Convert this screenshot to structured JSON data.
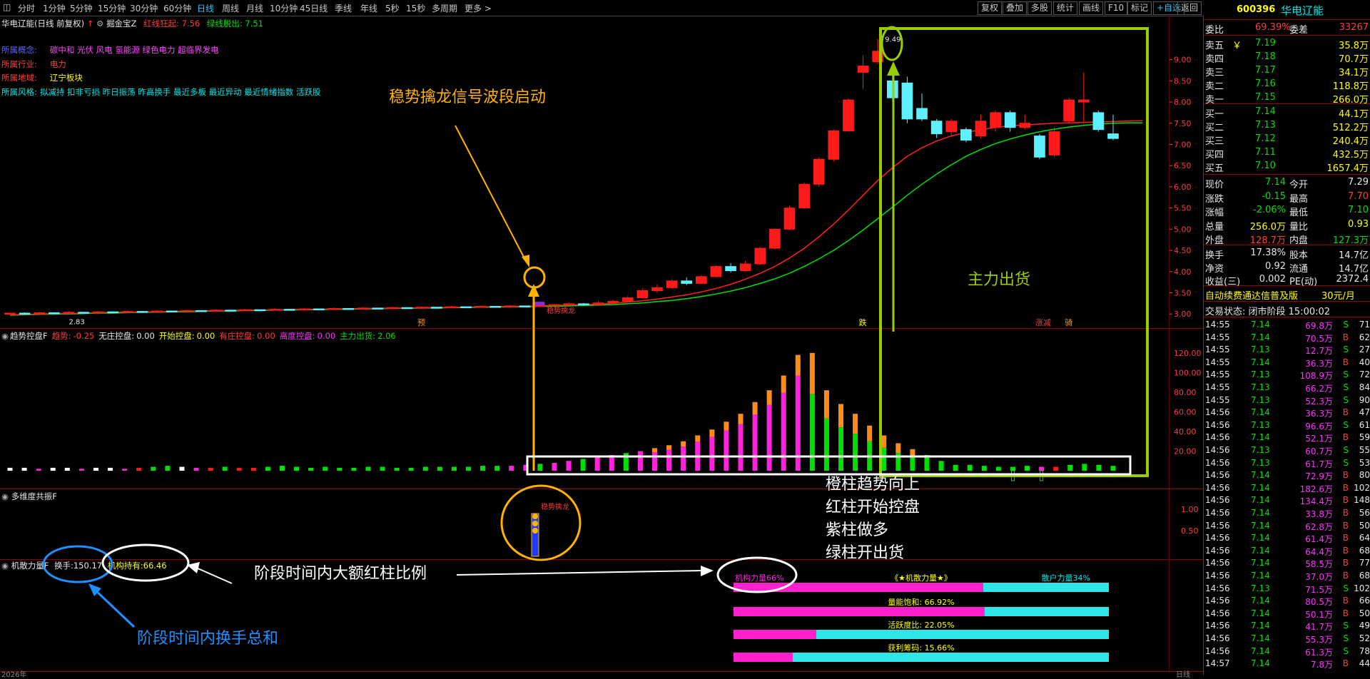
{
  "toolbar": {
    "periods": [
      "分时",
      "1分钟",
      "5分钟",
      "15分钟",
      "30分钟",
      "60分钟",
      "日线",
      "周线",
      "月线",
      "10分钟",
      "45日线",
      "季线",
      "年线",
      "5秒",
      "15秒",
      "多周期",
      "更多 >"
    ],
    "active_period": "日线",
    "buttons": [
      "复权",
      "叠加",
      "多股",
      "统计",
      "画线",
      "F10",
      "标记",
      "+自选",
      "返回"
    ]
  },
  "main_chart": {
    "title": "华电辽能(日线 前复权)",
    "indicator_name": "掘金宝Z",
    "red_line_label": "红线狂起: 7.56",
    "green_line_label": "绿线脱出: 7.51",
    "info_lines": [
      {
        "key": "所属概念:",
        "value": "碳中和 光伏 风电 氢能源 绿色电力 超临界发电",
        "key_color": "#6060ff",
        "value_color": "#ff44ff"
      },
      {
        "key": "所属行业:",
        "value": "电力",
        "key_color": "#ff3c3c",
        "value_color": "#ff3c3c"
      },
      {
        "key": "所属地域:",
        "value": "辽宁板块",
        "key_color": "#ff3c3c",
        "value_color": "#ffff00"
      },
      {
        "key": "所属风格:",
        "value": "拟减持 扣非亏损 昨日振荡 昨高换手 最近多板 最近异动 最近情绪指数 活跃股",
        "key_color": "#00e5e5",
        "value_color": "#00e5e5"
      }
    ],
    "y_ticks": [
      "9.00",
      "8.50",
      "8.00",
      "7.50",
      "7.00",
      "6.50",
      "6.00",
      "5.50",
      "5.00",
      "4.50",
      "4.00",
      "3.50",
      "3.00"
    ],
    "high_label": "9.49",
    "low_label": "2.83",
    "signal_label": "稳势擒龙",
    "bottom_marks": [
      "预",
      "跌",
      "涨减",
      "骑"
    ]
  },
  "trend_panel": {
    "title": "趋势控盘F",
    "fields": [
      {
        "label": "趋势:",
        "value": "-0.25",
        "color": "#ff3c3c"
      },
      {
        "label": "无庄控盘:",
        "value": "0.00",
        "color": "#e6e6e6"
      },
      {
        "label": "开始控盘:",
        "value": "0.00",
        "color": "#ffff00"
      },
      {
        "label": "有庄控盘:",
        "value": "0.00",
        "color": "#ff3c3c"
      },
      {
        "label": "高度控盘:",
        "value": "0.00",
        "color": "#ff33ff"
      },
      {
        "label": "主力出货:",
        "value": "2.06",
        "color": "#00e000"
      }
    ],
    "y_ticks": [
      "120.00",
      "100.00",
      "80.00",
      "60.00",
      "40.00",
      "20.00"
    ]
  },
  "resonance_panel": {
    "title": "多维度共振F",
    "signal_label": "稳势擒龙",
    "y_ticks": [
      "1.00",
      "0.50"
    ]
  },
  "force_panel": {
    "title": "机散力量F",
    "turnover_label": "换手:",
    "turnover_value": "150.17",
    "inst_label": "机构持有:",
    "inst_value": "66.46",
    "bars": [
      {
        "left_label": "机构力量66%",
        "center_label": "《★机散力量★》",
        "right_label": "散户力量34%",
        "fraction": 0.665
      },
      {
        "center_label": "量能饱和:  66.92%",
        "fraction": 0.669
      },
      {
        "center_label": "活跃度比:  22.05%",
        "fraction": 0.22
      },
      {
        "center_label": "获利筹码:  15.66%",
        "fraction": 0.157
      }
    ]
  },
  "footer": {
    "year_label": "2026年",
    "date_tick": "日线"
  },
  "annotations": {
    "signal_start": "稳势擒龙信号波段启动",
    "main_sell": "主力出货",
    "legend_lines": [
      "橙柱趋势向上",
      "红柱开始控盘",
      "紫柱做多",
      "绿柱开出货"
    ],
    "ratio_note": "阶段时间内大额红柱比例",
    "turnover_note": "阶段时间内换手总和"
  },
  "quote": {
    "code": "600396",
    "name": "华电辽能",
    "webi_label": "委比",
    "webi_value": "69.39%",
    "weicha_label": "委差",
    "weicha_value": "33267",
    "asks": [
      {
        "label": "卖五",
        "flag": "￥",
        "price": "7.19",
        "vol": "35.8万"
      },
      {
        "label": "卖四",
        "flag": "",
        "price": "7.18",
        "vol": "70.7万"
      },
      {
        "label": "卖三",
        "flag": "",
        "price": "7.17",
        "vol": "34.1万"
      },
      {
        "label": "卖二",
        "flag": "",
        "price": "7.16",
        "vol": "118.8万"
      },
      {
        "label": "卖一",
        "flag": "",
        "price": "7.15",
        "vol": "266.0万"
      }
    ],
    "bids": [
      {
        "label": "买一",
        "price": "7.14",
        "vol": "44.1万"
      },
      {
        "label": "买二",
        "price": "7.13",
        "vol": "512.2万"
      },
      {
        "label": "买三",
        "price": "7.12",
        "vol": "240.4万"
      },
      {
        "label": "买四",
        "price": "7.11",
        "vol": "432.5万"
      },
      {
        "label": "买五",
        "price": "7.10",
        "vol": "1657.4万"
      }
    ],
    "stats": [
      {
        "l1": "现价",
        "v1": "7.14",
        "c1": "#00e000",
        "l2": "今开",
        "v2": "7.29",
        "c2": "#e6e6e6"
      },
      {
        "l1": "涨跌",
        "v1": "-0.15",
        "c1": "#00e000",
        "l2": "最高",
        "v2": "7.70",
        "c2": "#ff3c3c"
      },
      {
        "l1": "涨幅",
        "v1": "-2.06%",
        "c1": "#00e000",
        "l2": "最低",
        "v2": "7.10",
        "c2": "#00e000"
      },
      {
        "l1": "总量",
        "v1": "256.0万",
        "c1": "#ffff00",
        "l2": "量比",
        "v2": "0.93",
        "c2": "#ffff00"
      },
      {
        "l1": "外盘",
        "v1": "128.7万",
        "c1": "#ff3c3c",
        "l2": "内盘",
        "v2": "127.3万",
        "c2": "#00e000"
      }
    ],
    "stats2": [
      {
        "l1": "换手",
        "v1": "17.38%",
        "l2": "股本",
        "v2": "14.7亿"
      },
      {
        "l1": "净资",
        "v1": "0.92",
        "l2": "流通",
        "v2": "14.7亿"
      },
      {
        "l1": "收益(三)",
        "v1": "0.002",
        "l2": "PE(动)",
        "v2": "2372.4"
      }
    ],
    "promo": "自动续费通达信普及版",
    "promo_price": "30元/月",
    "trade_status": "交易状态: 闭市阶段 15:00:02",
    "ticks": [
      {
        "t": "14:55",
        "p": "7.14",
        "v": "69.8万",
        "s": "S",
        "n": "71"
      },
      {
        "t": "14:55",
        "p": "7.14",
        "v": "70.5万",
        "s": "B",
        "n": "62"
      },
      {
        "t": "14:55",
        "p": "7.13",
        "v": "12.7万",
        "s": "S",
        "n": "27"
      },
      {
        "t": "14:55",
        "p": "7.14",
        "v": "36.3万",
        "s": "B",
        "n": "40"
      },
      {
        "t": "14:55",
        "p": "7.13",
        "v": "108.9万",
        "s": "S",
        "n": "72"
      },
      {
        "t": "14:55",
        "p": "7.13",
        "v": "66.2万",
        "s": "S",
        "n": "84"
      },
      {
        "t": "14:55",
        "p": "7.13",
        "v": "52.3万",
        "s": "S",
        "n": "90"
      },
      {
        "t": "14:56",
        "p": "7.14",
        "v": "36.3万",
        "s": "B",
        "n": "47"
      },
      {
        "t": "14:56",
        "p": "7.13",
        "v": "96.6万",
        "s": "S",
        "n": "61"
      },
      {
        "t": "14:56",
        "p": "7.14",
        "v": "52.1万",
        "s": "B",
        "n": "59"
      },
      {
        "t": "14:56",
        "p": "7.13",
        "v": "60.7万",
        "s": "S",
        "n": "55"
      },
      {
        "t": "14:56",
        "p": "7.13",
        "v": "61.7万",
        "s": "S",
        "n": "53"
      },
      {
        "t": "14:56",
        "p": "7.14",
        "v": "72.9万",
        "s": "B",
        "n": "80"
      },
      {
        "t": "14:56",
        "p": "7.14",
        "v": "182.6万",
        "s": "B",
        "n": "102"
      },
      {
        "t": "14:56",
        "p": "7.14",
        "v": "134.4万",
        "s": "B",
        "n": "148"
      },
      {
        "t": "14:56",
        "p": "7.14",
        "v": "33.8万",
        "s": "B",
        "n": "56"
      },
      {
        "t": "14:56",
        "p": "7.14",
        "v": "62.8万",
        "s": "B",
        "n": "50"
      },
      {
        "t": "14:56",
        "p": "7.14",
        "v": "61.4万",
        "s": "B",
        "n": "64"
      },
      {
        "t": "14:56",
        "p": "7.14",
        "v": "64.4万",
        "s": "B",
        "n": "68"
      },
      {
        "t": "14:56",
        "p": "7.14",
        "v": "58.5万",
        "s": "B",
        "n": "77"
      },
      {
        "t": "14:56",
        "p": "7.14",
        "v": "37.0万",
        "s": "B",
        "n": "68"
      },
      {
        "t": "14:56",
        "p": "7.13",
        "v": "71.5万",
        "s": "S",
        "n": "102"
      },
      {
        "t": "14:56",
        "p": "7.14",
        "v": "80.5万",
        "s": "B",
        "n": "66"
      },
      {
        "t": "14:56",
        "p": "7.14",
        "v": "50.1万",
        "s": "B",
        "n": "50"
      },
      {
        "t": "14:56",
        "p": "7.14",
        "v": "41.7万",
        "s": "S",
        "n": "49"
      },
      {
        "t": "14:56",
        "p": "7.14",
        "v": "55.3万",
        "s": "S",
        "n": "52"
      },
      {
        "t": "14:56",
        "p": "7.14",
        "v": "61.3万",
        "s": "S",
        "n": "78"
      },
      {
        "t": "14:57",
        "p": "7.14",
        "v": "7.8万",
        "s": "B",
        "n": "44"
      }
    ]
  },
  "chart_data": {
    "type": "candlestick",
    "ylim": [
      2.7,
      9.6
    ],
    "candles": [
      {
        "o": 3.0,
        "c": 3.02,
        "h": 3.03,
        "l": 2.99
      },
      {
        "o": 3.02,
        "c": 3.01,
        "h": 3.04,
        "l": 3.0
      },
      {
        "o": 3.01,
        "c": 3.03,
        "h": 3.05,
        "l": 3.0
      },
      {
        "o": 3.03,
        "c": 3.02,
        "h": 3.04,
        "l": 3.0
      },
      {
        "o": 3.02,
        "c": 3.04,
        "h": 3.06,
        "l": 3.01
      },
      {
        "o": 3.04,
        "c": 3.03,
        "h": 3.05,
        "l": 3.02
      },
      {
        "o": 3.03,
        "c": 3.05,
        "h": 3.07,
        "l": 3.02
      },
      {
        "o": 3.05,
        "c": 3.04,
        "h": 3.06,
        "l": 3.03
      },
      {
        "o": 3.04,
        "c": 3.06,
        "h": 3.08,
        "l": 3.03
      },
      {
        "o": 3.06,
        "c": 3.05,
        "h": 3.07,
        "l": 3.04
      },
      {
        "o": 3.05,
        "c": 3.07,
        "h": 3.09,
        "l": 3.04
      },
      {
        "o": 3.07,
        "c": 3.06,
        "h": 3.08,
        "l": 3.05
      },
      {
        "o": 3.06,
        "c": 3.08,
        "h": 3.1,
        "l": 3.05
      },
      {
        "o": 3.08,
        "c": 3.07,
        "h": 3.09,
        "l": 3.06
      },
      {
        "o": 3.07,
        "c": 3.09,
        "h": 3.11,
        "l": 3.06
      },
      {
        "o": 3.09,
        "c": 3.08,
        "h": 3.1,
        "l": 3.07
      },
      {
        "o": 3.08,
        "c": 3.1,
        "h": 3.12,
        "l": 3.07
      },
      {
        "o": 3.1,
        "c": 3.09,
        "h": 3.11,
        "l": 3.08
      },
      {
        "o": 3.09,
        "c": 3.11,
        "h": 3.13,
        "l": 3.08
      },
      {
        "o": 3.11,
        "c": 3.1,
        "h": 3.12,
        "l": 3.09
      },
      {
        "o": 3.1,
        "c": 3.12,
        "h": 3.14,
        "l": 3.09
      },
      {
        "o": 3.12,
        "c": 3.11,
        "h": 3.13,
        "l": 3.1
      },
      {
        "o": 3.11,
        "c": 3.13,
        "h": 3.15,
        "l": 3.1
      },
      {
        "o": 3.13,
        "c": 3.12,
        "h": 3.14,
        "l": 3.11
      },
      {
        "o": 3.12,
        "c": 3.14,
        "h": 3.16,
        "l": 3.11
      },
      {
        "o": 3.14,
        "c": 3.13,
        "h": 3.15,
        "l": 3.12
      },
      {
        "o": 3.13,
        "c": 3.15,
        "h": 3.17,
        "l": 3.12
      },
      {
        "o": 3.15,
        "c": 3.14,
        "h": 3.16,
        "l": 3.13
      },
      {
        "o": 3.14,
        "c": 3.16,
        "h": 3.18,
        "l": 3.13
      },
      {
        "o": 3.16,
        "c": 3.15,
        "h": 3.17,
        "l": 3.14
      },
      {
        "o": 3.15,
        "c": 3.17,
        "h": 3.19,
        "l": 3.14
      },
      {
        "o": 3.17,
        "c": 3.16,
        "h": 3.18,
        "l": 3.15
      },
      {
        "o": 3.16,
        "c": 3.18,
        "h": 3.2,
        "l": 3.15
      },
      {
        "o": 3.18,
        "c": 3.17,
        "h": 3.19,
        "l": 3.16
      },
      {
        "o": 3.17,
        "c": 3.19,
        "h": 3.21,
        "l": 3.16
      },
      {
        "o": 3.19,
        "c": 3.18,
        "h": 3.2,
        "l": 3.17
      },
      {
        "o": 3.18,
        "c": 3.2,
        "h": 3.22,
        "l": 3.17
      },
      {
        "o": 3.2,
        "c": 3.22,
        "h": 3.24,
        "l": 3.19
      },
      {
        "o": 3.22,
        "c": 3.24,
        "h": 3.28,
        "l": 3.21
      },
      {
        "o": 3.24,
        "c": 3.22,
        "h": 3.26,
        "l": 3.2
      },
      {
        "o": 3.22,
        "c": 3.26,
        "h": 3.3,
        "l": 3.21
      },
      {
        "o": 3.26,
        "c": 3.3,
        "h": 3.33,
        "l": 3.25
      },
      {
        "o": 3.3,
        "c": 3.38,
        "h": 3.42,
        "l": 3.28
      },
      {
        "o": 3.38,
        "c": 3.55,
        "h": 3.6,
        "l": 3.36
      },
      {
        "o": 3.55,
        "c": 3.62,
        "h": 3.7,
        "l": 3.5
      },
      {
        "o": 3.62,
        "c": 3.78,
        "h": 3.82,
        "l": 3.6
      },
      {
        "o": 3.78,
        "c": 3.72,
        "h": 3.86,
        "l": 3.68
      },
      {
        "o": 3.72,
        "c": 3.88,
        "h": 3.92,
        "l": 3.7
      },
      {
        "o": 3.88,
        "c": 4.12,
        "h": 4.15,
        "l": 3.86
      },
      {
        "o": 4.12,
        "c": 4.02,
        "h": 4.2,
        "l": 3.98
      },
      {
        "o": 4.02,
        "c": 4.18,
        "h": 4.25,
        "l": 4.0
      },
      {
        "o": 4.18,
        "c": 4.55,
        "h": 4.58,
        "l": 4.15
      },
      {
        "o": 4.55,
        "c": 5.0,
        "h": 5.02,
        "l": 4.52
      },
      {
        "o": 5.0,
        "c": 5.5,
        "h": 5.55,
        "l": 4.98
      },
      {
        "o": 5.5,
        "c": 6.06,
        "h": 6.1,
        "l": 5.48
      },
      {
        "o": 6.06,
        "c": 6.65,
        "h": 6.7,
        "l": 6.0
      },
      {
        "o": 6.65,
        "c": 7.32,
        "h": 7.35,
        "l": 6.6
      },
      {
        "o": 7.32,
        "c": 8.05,
        "h": 8.08,
        "l": 7.3
      },
      {
        "o": 8.7,
        "c": 8.85,
        "h": 9.1,
        "l": 8.3
      },
      {
        "o": 8.95,
        "c": 9.2,
        "h": 9.49,
        "l": 8.9
      },
      {
        "o": 8.5,
        "c": 8.1,
        "h": 8.7,
        "l": 8.0
      },
      {
        "o": 8.45,
        "c": 7.6,
        "h": 8.6,
        "l": 7.5
      },
      {
        "o": 7.85,
        "c": 7.6,
        "h": 8.2,
        "l": 7.55
      },
      {
        "o": 7.55,
        "c": 7.25,
        "h": 7.6,
        "l": 7.15
      },
      {
        "o": 7.3,
        "c": 7.55,
        "h": 7.6,
        "l": 7.2
      },
      {
        "o": 7.35,
        "c": 7.1,
        "h": 7.4,
        "l": 7.05
      },
      {
        "o": 7.2,
        "c": 7.55,
        "h": 7.7,
        "l": 7.15
      },
      {
        "o": 7.4,
        "c": 7.75,
        "h": 7.8,
        "l": 7.3
      },
      {
        "o": 7.75,
        "c": 7.4,
        "h": 7.8,
        "l": 7.3
      },
      {
        "o": 7.4,
        "c": 7.5,
        "h": 7.7,
        "l": 7.35
      },
      {
        "o": 7.2,
        "c": 6.7,
        "h": 7.25,
        "l": 6.65
      },
      {
        "o": 6.75,
        "c": 7.3,
        "h": 7.4,
        "l": 6.7
      },
      {
        "o": 7.55,
        "c": 8.05,
        "h": 8.1,
        "l": 7.5
      },
      {
        "o": 8.0,
        "c": 8.05,
        "h": 8.7,
        "l": 7.5
      },
      {
        "o": 7.75,
        "c": 7.35,
        "h": 7.8,
        "l": 7.3
      },
      {
        "o": 7.25,
        "c": 7.14,
        "h": 7.7,
        "l": 7.1
      }
    ],
    "ma_red": [
      2.98,
      2.99,
      3.0,
      3.01,
      3.01,
      3.02,
      3.03,
      3.04,
      3.04,
      3.05,
      3.05,
      3.06,
      3.07,
      3.07,
      3.08,
      3.08,
      3.09,
      3.09,
      3.1,
      3.1,
      3.11,
      3.11,
      3.12,
      3.12,
      3.13,
      3.13,
      3.14,
      3.14,
      3.15,
      3.15,
      3.16,
      3.16,
      3.17,
      3.17,
      3.18,
      3.18,
      3.19,
      3.2,
      3.21,
      3.22,
      3.23,
      3.25,
      3.28,
      3.31,
      3.35,
      3.4,
      3.45,
      3.52,
      3.6,
      3.7,
      3.82,
      3.96,
      4.12,
      4.32,
      4.55,
      4.82,
      5.12,
      5.45,
      5.8,
      6.15,
      6.45,
      6.72,
      6.92,
      7.08,
      7.2,
      7.28,
      7.35,
      7.4,
      7.44,
      7.46,
      7.48,
      7.5,
      7.51,
      7.52,
      7.53,
      7.54,
      7.55,
      7.56
    ],
    "ma_green": [
      2.97,
      2.98,
      2.99,
      3.0,
      3.0,
      3.01,
      3.02,
      3.02,
      3.03,
      3.04,
      3.04,
      3.05,
      3.05,
      3.06,
      3.07,
      3.07,
      3.08,
      3.08,
      3.09,
      3.09,
      3.1,
      3.1,
      3.11,
      3.11,
      3.12,
      3.12,
      3.13,
      3.13,
      3.14,
      3.14,
      3.15,
      3.15,
      3.16,
      3.16,
      3.17,
      3.17,
      3.18,
      3.18,
      3.19,
      3.2,
      3.21,
      3.22,
      3.24,
      3.26,
      3.29,
      3.32,
      3.36,
      3.41,
      3.47,
      3.54,
      3.62,
      3.72,
      3.83,
      3.96,
      4.12,
      4.3,
      4.5,
      4.73,
      4.98,
      5.25,
      5.52,
      5.8,
      6.06,
      6.3,
      6.52,
      6.72,
      6.88,
      7.02,
      7.13,
      7.22,
      7.3,
      7.36,
      7.41,
      7.45,
      7.48,
      7.5,
      7.51,
      7.51
    ],
    "trend_bars": [
      3,
      3,
      2,
      3,
      3,
      2,
      3,
      3,
      2,
      3,
      4,
      5,
      4,
      3,
      3,
      4,
      3,
      3,
      4,
      5,
      4,
      3,
      4,
      3,
      3,
      4,
      4,
      3,
      3,
      4,
      4,
      4,
      4,
      5,
      5,
      5,
      6,
      7,
      8,
      10,
      12,
      14,
      16,
      18,
      20,
      23,
      26,
      30,
      36,
      42,
      50,
      58,
      70,
      82,
      97,
      118,
      120,
      82,
      68,
      58,
      46,
      36,
      28,
      22,
      16,
      10,
      6,
      6,
      5,
      4,
      4,
      5,
      4,
      4,
      6,
      7,
      6,
      5
    ],
    "trend_colors": [
      "w",
      "w",
      "m",
      "w",
      "w",
      "m",
      "w",
      "w",
      "m",
      "r",
      "g",
      "g",
      "w",
      "m",
      "r",
      "g",
      "r",
      "r",
      "g",
      "g",
      "g",
      "g",
      "g",
      "g",
      "g",
      "g",
      "g",
      "g",
      "g",
      "g",
      "g",
      "g",
      "g",
      "g",
      "g",
      "m",
      "m",
      "g",
      "m",
      "m",
      "g",
      "m",
      "m",
      "g",
      "m",
      "m",
      "m",
      "m",
      "m",
      "m",
      "m",
      "m",
      "m",
      "m",
      "m",
      "m",
      "g",
      "g",
      "g",
      "g",
      "g",
      "g",
      "g",
      "g",
      "g",
      "g",
      "g",
      "g",
      "g",
      "g",
      "g",
      "g",
      "m",
      "r",
      "g",
      "g",
      "g",
      "g"
    ],
    "title": "",
    "xlabel": "",
    "ylabel": ""
  }
}
